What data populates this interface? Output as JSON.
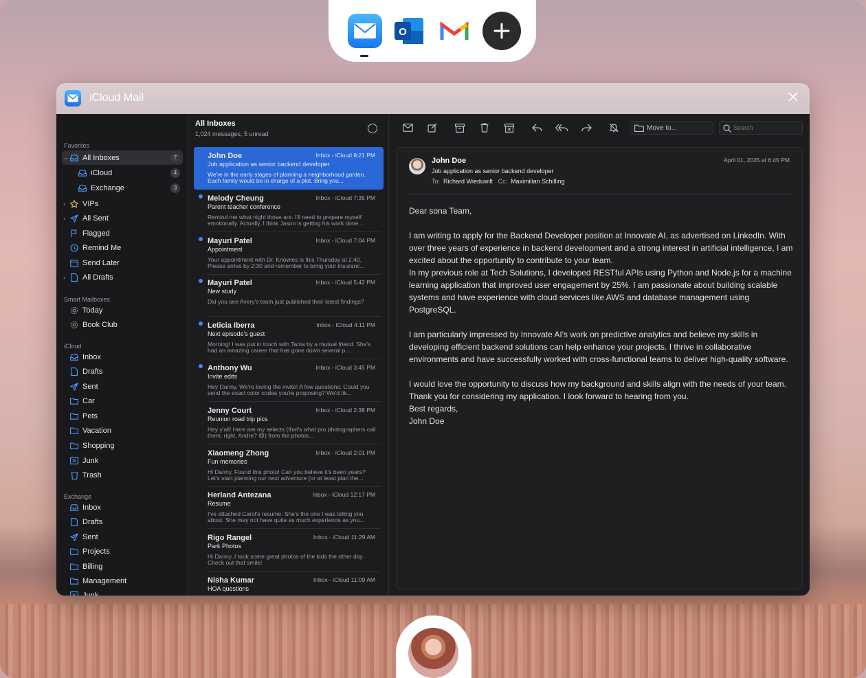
{
  "dock": {
    "apps": [
      {
        "name": "Apple Mail"
      },
      {
        "name": "Outlook"
      },
      {
        "name": "Gmail"
      },
      {
        "name": "Add"
      }
    ]
  },
  "window": {
    "title": "iCloud Mail"
  },
  "sidebar": {
    "sections": {
      "favorites": "Favorites",
      "smart": "Smart Mailboxes",
      "icloud": "iCloud",
      "exchange": "Exchange"
    },
    "favorites": [
      {
        "label": "All Inboxes",
        "count": "7"
      },
      {
        "label": "iCloud",
        "count": "4"
      },
      {
        "label": "Exchange",
        "count": "3"
      },
      {
        "label": "VIPs"
      },
      {
        "label": "All Sent"
      },
      {
        "label": "Flagged"
      },
      {
        "label": "Remind Me"
      },
      {
        "label": "Send Later"
      },
      {
        "label": "All Drafts"
      }
    ],
    "smart": [
      {
        "label": "Today"
      },
      {
        "label": "Book Club"
      }
    ],
    "icloud": [
      {
        "label": "Inbox"
      },
      {
        "label": "Drafts"
      },
      {
        "label": "Sent"
      },
      {
        "label": "Car"
      },
      {
        "label": "Pets"
      },
      {
        "label": "Vacation"
      },
      {
        "label": "Shopping"
      },
      {
        "label": "Junk"
      },
      {
        "label": "Trash"
      }
    ],
    "exchange": [
      {
        "label": "Inbox"
      },
      {
        "label": "Drafts"
      },
      {
        "label": "Sent"
      },
      {
        "label": "Projects"
      },
      {
        "label": "Billing"
      },
      {
        "label": "Management"
      },
      {
        "label": "Junk"
      }
    ]
  },
  "list": {
    "title": "All Inboxes",
    "subtitle": "1,024 messages, 5 unread",
    "messages": [
      {
        "from": "John Doe",
        "meta": "Inbox - iCloud   8:21 PM",
        "subject": "Job application as senior backend developer",
        "preview": "We're in the early stages of planning a neighborhood garden. Each family would be in charge of a plot. Bring you..."
      },
      {
        "from": "Melody Cheung",
        "meta": "Inbox - iCloud   7:35 PM",
        "subject": "Parent teacher conference",
        "preview": "Remind me what night those are. I'll need to prepare myself emotionally. Actually, I think Jason is getting his work done..."
      },
      {
        "from": "Mayuri Patel",
        "meta": "Inbox - iCloud   7:04 PM",
        "subject": "Appointment",
        "preview": "Your appointment with Dr. Knowles is this Thursday at 2:40. Please arrive by 2:30 and remember to bring your insuranc..."
      },
      {
        "from": "Mayuri Patel",
        "meta": "Inbox - iCloud   5:42 PM",
        "subject": "New study",
        "preview": "Did you see Avery's team just published their latest findings?"
      },
      {
        "from": "Leticia Iberra",
        "meta": "Inbox - iCloud   4:11 PM",
        "subject": "Next episode's guest",
        "preview": "Morning! I was put in touch with Tania by a mutual friend. She's had an amazing career that has gone down several p..."
      },
      {
        "from": "Anthony Wu",
        "meta": "Inbox - iCloud   3:45 PM",
        "subject": "Invite edits",
        "preview": "Hey Danny, We're loving the invite! A few questions: Could you send the exact color codes you're proposing? We'd lik..."
      },
      {
        "from": "Jenny Court",
        "meta": "Inbox - iCloud   2:38 PM",
        "subject": "Reunion road trip pics",
        "preview": "Hey y'all! Here are my selects (that's what pro photographers call them, right, Andre? 😄) from the photos..."
      },
      {
        "from": "Xiaomeng Zhong",
        "meta": "Inbox - iCloud   2:01 PM",
        "subject": "Fun memories",
        "preview": "Hi Danny, Found this photo! Can you believe it's been years? Let's start planning our next adventure (or at least plan the..."
      },
      {
        "from": "Herland Antezana",
        "meta": "Inbox - iCloud   12:17 PM",
        "subject": "Resume",
        "preview": "I've attached Carol's resume. She's the one I was telling you about. She may not have quite as much experience as you..."
      },
      {
        "from": "Rigo Rangel",
        "meta": "Inbox - iCloud   11:29 AM",
        "subject": "Park Photos",
        "preview": "Hi Danny, I took some great photos of the kids the other day. Check out that smile!"
      },
      {
        "from": "Nisha Kumar",
        "meta": "Inbox - iCloud   11:09 AM",
        "subject": "HOA questions",
        "preview": ""
      }
    ]
  },
  "toolbar": {
    "move_to": "Move to...",
    "search_placeholder": "Search"
  },
  "reader": {
    "from": "John Doe",
    "subject": "Job application as senior backend developer",
    "to_label": "To:",
    "to": "Richard Wieduwilt",
    "cc_label": "Cc:",
    "cc": "Maximilian Schilling",
    "date": "April 01, 2025 at 6:45 PM",
    "greeting": "Dear sona Team,",
    "p1": "I am writing to  apply for the Backend Developer position at Innovate AI, as advertised  on LinkedIn. With over three years of experience in backend development  and a strong interest in artificial intelligence, I am excited about the opportunity to contribute to your team.",
    "p2": "In my previous role at  Tech Solutions, I developed RESTful APIs using Python and Node.js for a machine learning application that improved user engagement by 25%. I am  passionate about building scalable systems and have experience with  cloud services like AWS and database management using PostgreSQL.",
    "p3": "I am particularly impressed by Innovate AI's work on predictive analytics and believe my skills in developing efficient backend solutions can  help enhance your projects. I thrive in collaborative environments and  have successfully worked with cross-functional teams to deliver  high-quality software.",
    "p4": "I would love the opportunity to discuss how my background and skills align with the needs of your team. Thank you  for considering my application. I look forward to hearing from you.",
    "closing": "Best regards,",
    "signature": "John Doe"
  },
  "colors": {
    "accent": "#2a68d8",
    "unread_dot": "#3d8bff"
  }
}
